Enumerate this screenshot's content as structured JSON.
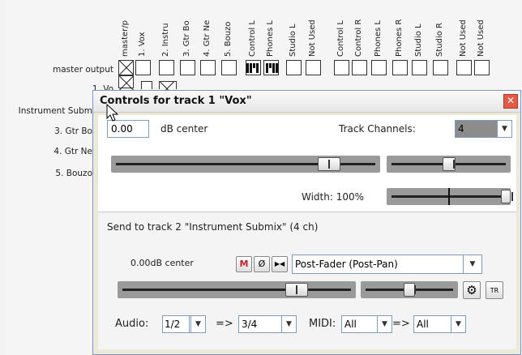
{
  "matrix": {
    "columns": [
      "master/p",
      "1. Vox",
      "2. Instru",
      "3. Gtr Bo",
      "4. Gtr Ne",
      "5. Bouzo",
      "Control L",
      "Phones L",
      "Studio L",
      "Not Used",
      "Control L",
      "Control R",
      "Phones L",
      "Phones R",
      "Studio L",
      "Studio R",
      "Not Used",
      "Not Used"
    ],
    "rows": [
      "master output",
      "1. Vo",
      "Instrument Subm",
      "3. Gtr Bo",
      "4. Gtr Ne",
      "5. Bouzo"
    ]
  },
  "dialog": {
    "title": "Controls for track 1 \"Vox\"",
    "close_glyph": "✕",
    "volume_value": "0.00",
    "volume_suffix": "dB  center",
    "track_channels_label": "Track Channels:",
    "track_channels_value": "4",
    "volume_fader": 0.84,
    "pan_fader": 0.5,
    "width_label": "Width: 100%",
    "width_fader": 1.0,
    "send": {
      "heading": "Send to track 2 \"Instrument Submix\" (4 ch)",
      "level_text": "0.00dB center",
      "mute_label": "M",
      "phase_label": "Ø",
      "mono_label": "▶◀",
      "mode_value": "Post-Fader (Post-Pan)",
      "volume_fader": 0.78,
      "pan_fader": 0.5,
      "audio_label": "Audio:",
      "audio_src": "1/2",
      "arrow1": "=>",
      "audio_dst": "3/4",
      "midi_label": "MIDI:",
      "midi_src": "All",
      "arrow2": "=>",
      "midi_dst": "All",
      "fx_icon": "⚙",
      "tr_label": "TR"
    }
  },
  "colors": {
    "mute_text": "#c0202a",
    "dialog_bg": "#ece9d8",
    "fader_track": "#9a9a9a"
  }
}
